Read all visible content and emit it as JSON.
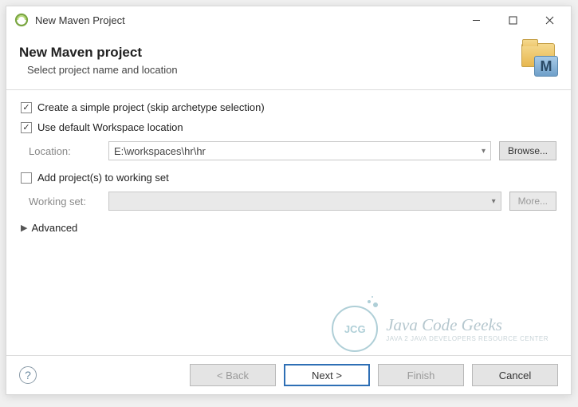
{
  "titlebar": {
    "title": "New Maven Project"
  },
  "header": {
    "title": "New Maven project",
    "subtitle": "Select project name and location",
    "icon_letter": "M"
  },
  "options": {
    "simple_project": {
      "label": "Create a simple project (skip archetype selection)",
      "checked": true
    },
    "default_workspace": {
      "label": "Use default Workspace location",
      "checked": true
    },
    "location": {
      "label": "Location:",
      "value": "E:\\workspaces\\hr\\hr",
      "browse": "Browse..."
    },
    "working_set_checkbox": {
      "label": "Add project(s) to working set",
      "checked": false
    },
    "working_set": {
      "label": "Working set:",
      "value": "",
      "more": "More..."
    },
    "advanced": "Advanced"
  },
  "watermark": {
    "badge": "JCG",
    "line1": "Java Code Geeks",
    "line2": "JAVA 2 JAVA DEVELOPERS RESOURCE CENTER"
  },
  "footer": {
    "back": "< Back",
    "next": "Next >",
    "finish": "Finish",
    "cancel": "Cancel"
  }
}
